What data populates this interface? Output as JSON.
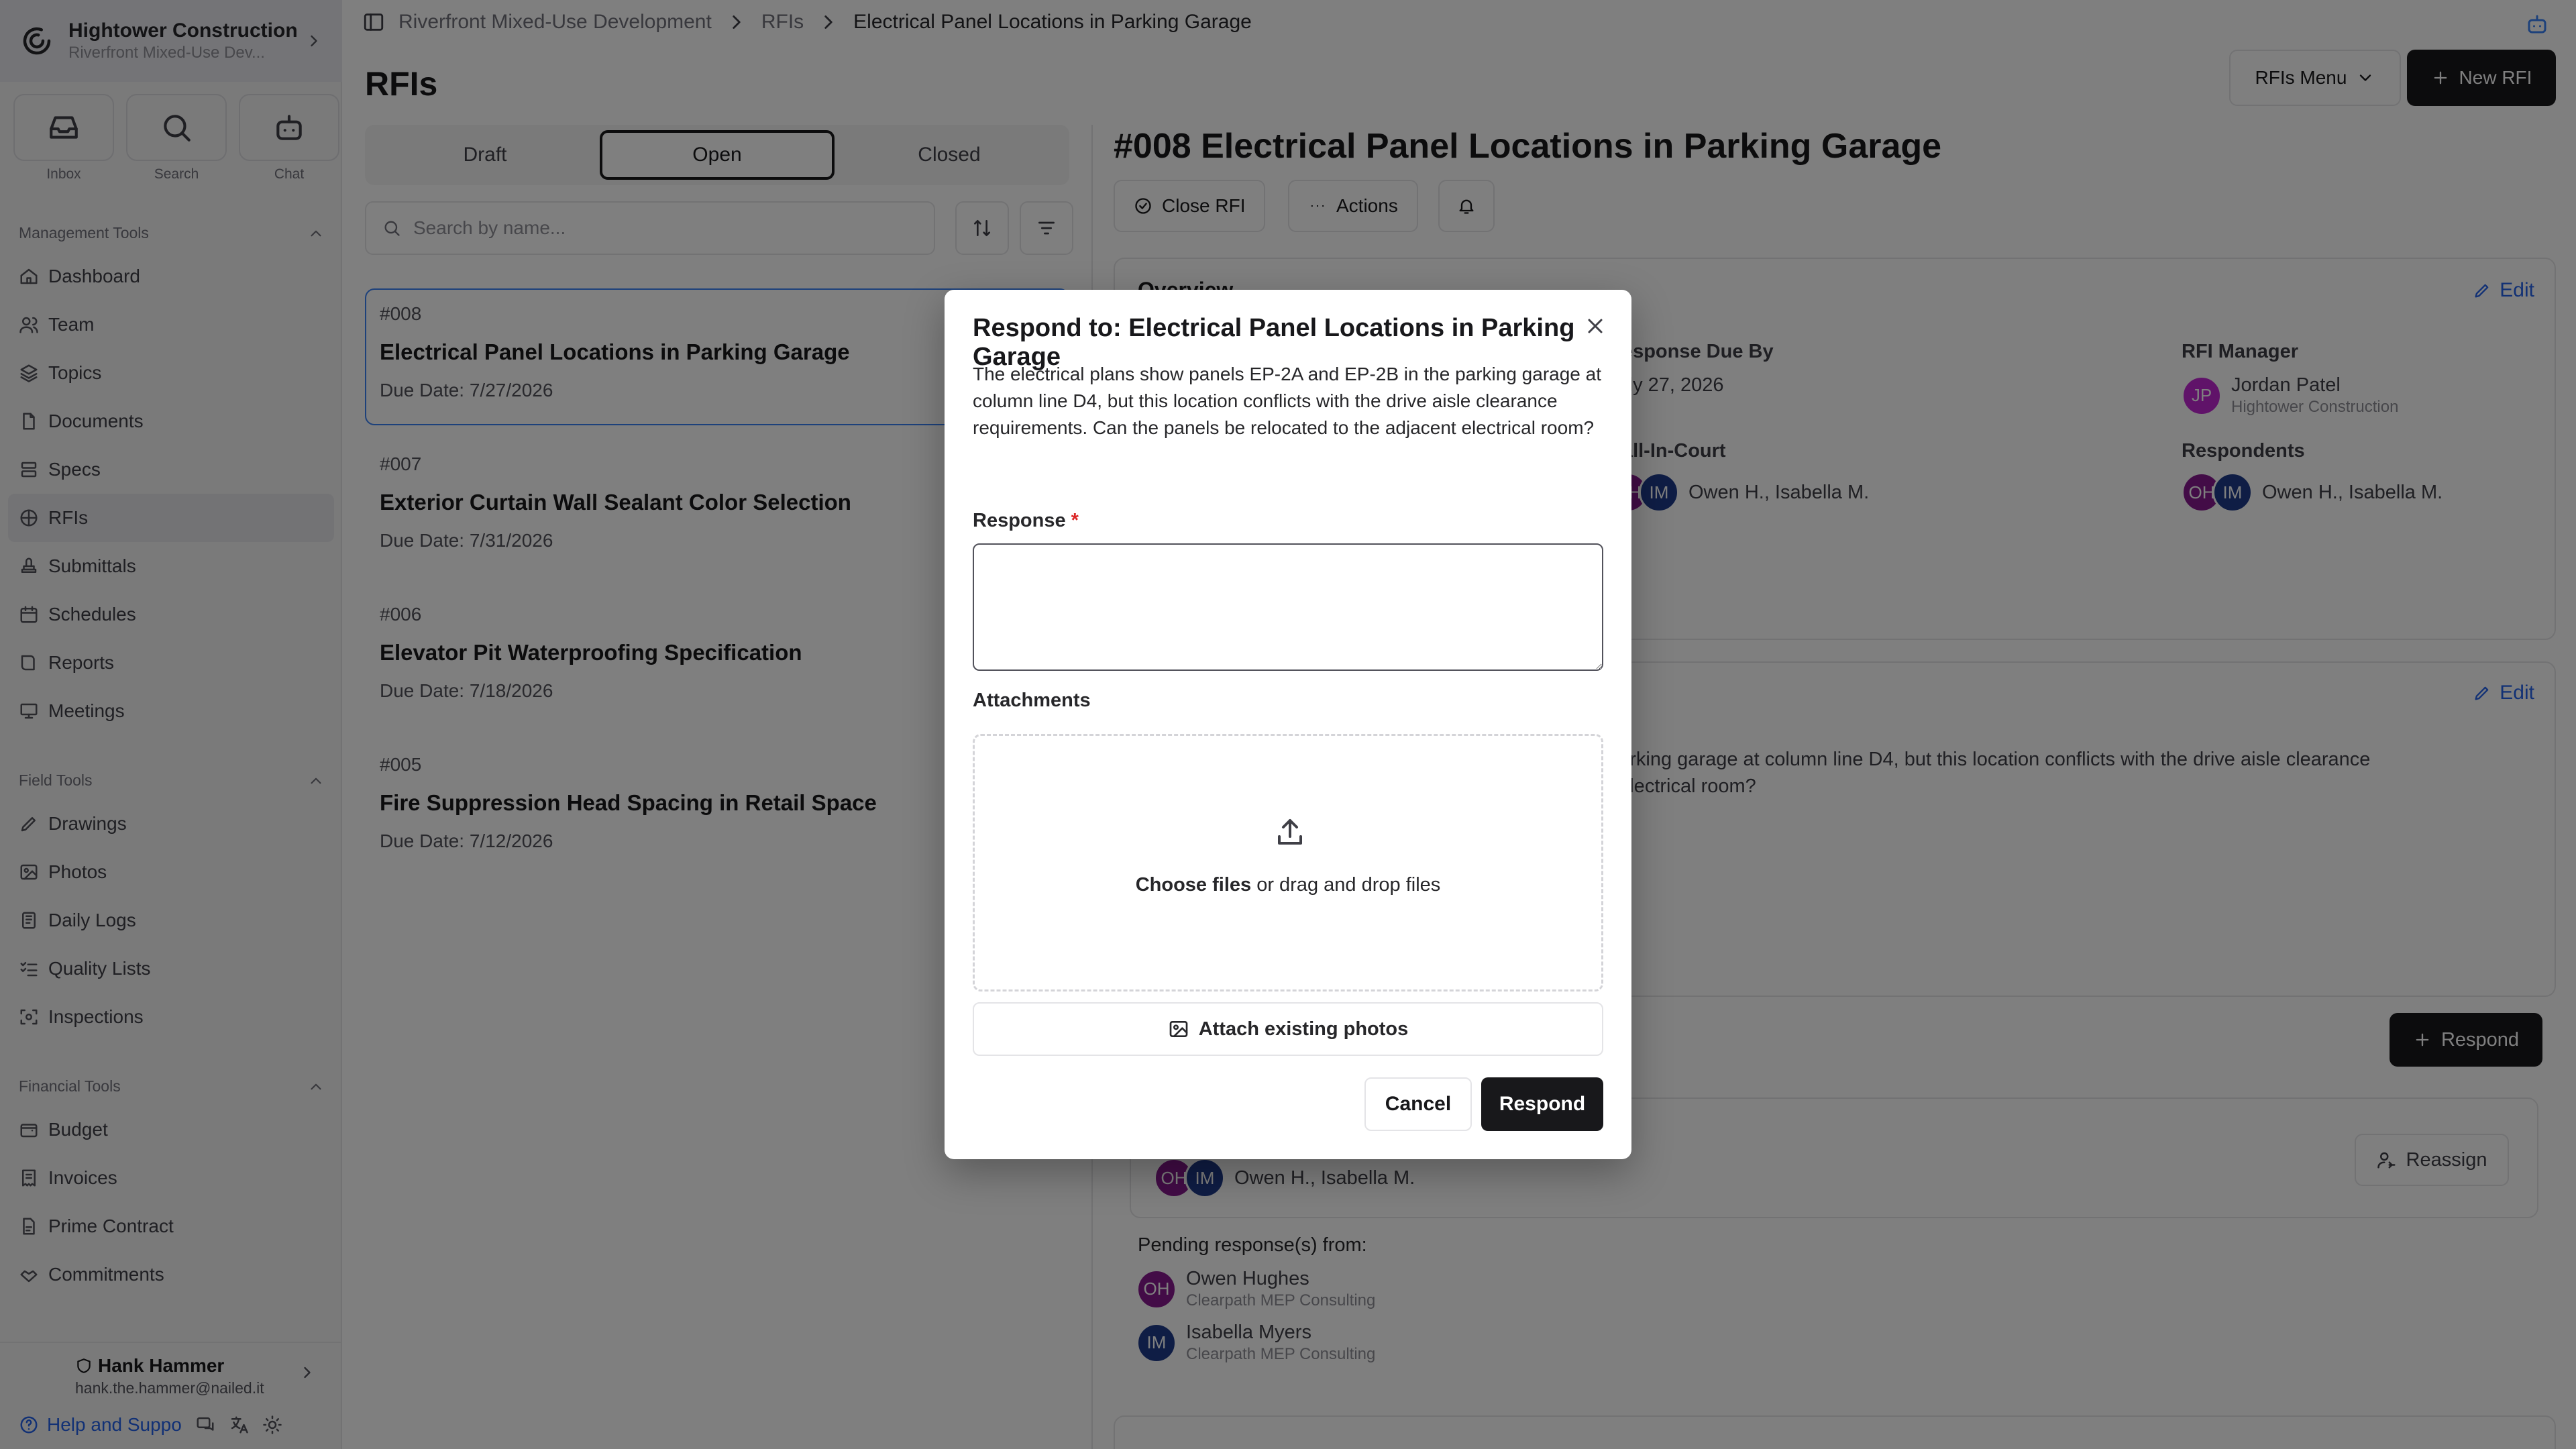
{
  "workspace": {
    "name": "Hightower Construction",
    "project": "Riverfront Mixed-Use Dev..."
  },
  "quick": {
    "inbox": "Inbox",
    "search": "Search",
    "chat": "Chat"
  },
  "sections": {
    "management": "Management Tools",
    "field": "Field Tools",
    "financial": "Financial Tools"
  },
  "nav_management": [
    {
      "label": "Dashboard",
      "icon": "home-icon"
    },
    {
      "label": "Team",
      "icon": "users-icon"
    },
    {
      "label": "Topics",
      "icon": "layers-icon"
    },
    {
      "label": "Documents",
      "icon": "file-icon"
    },
    {
      "label": "Specs",
      "icon": "stack-icon"
    },
    {
      "label": "RFIs",
      "icon": "rfi-icon"
    },
    {
      "label": "Submittals",
      "icon": "stamp-icon"
    },
    {
      "label": "Schedules",
      "icon": "calendar-icon"
    },
    {
      "label": "Reports",
      "icon": "book-icon"
    },
    {
      "label": "Meetings",
      "icon": "presentation-icon"
    }
  ],
  "nav_field": [
    {
      "label": "Drawings",
      "icon": "drawing-icon"
    },
    {
      "label": "Photos",
      "icon": "photo-icon"
    },
    {
      "label": "Daily Logs",
      "icon": "notebook-icon"
    },
    {
      "label": "Quality Lists",
      "icon": "checklist-icon"
    },
    {
      "label": "Inspections",
      "icon": "scan-icon"
    }
  ],
  "nav_financial": [
    {
      "label": "Budget",
      "icon": "wallet-icon"
    },
    {
      "label": "Invoices",
      "icon": "receipt-icon"
    },
    {
      "label": "Prime Contract",
      "icon": "contract-icon"
    },
    {
      "label": "Commitments",
      "icon": "handshake-icon"
    }
  ],
  "user": {
    "name": "Hank Hammer",
    "email": "hank.the.hammer@nailed.it"
  },
  "help": {
    "label": "Help and Suppo"
  },
  "breadcrumb": {
    "project": "Riverfront Mixed-Use Development",
    "section": "RFIs",
    "current": "Electrical Panel Locations in Parking Garage"
  },
  "page": {
    "title": "RFIs",
    "menu_label": "RFIs Menu",
    "new_label": "New RFI"
  },
  "tabs": [
    "Draft",
    "Open",
    "Closed"
  ],
  "search": {
    "placeholder": "Search by name..."
  },
  "rfis": [
    {
      "num": "#008",
      "title": "Electrical Panel Locations in Parking Garage",
      "due": "Due Date: 7/27/2026"
    },
    {
      "num": "#007",
      "title": "Exterior Curtain Wall Sealant Color Selection",
      "due": "Due Date: 7/31/2026"
    },
    {
      "num": "#006",
      "title": "Elevator Pit Waterproofing Specification",
      "due": "Due Date: 7/18/2026"
    },
    {
      "num": "#005",
      "title": "Fire Suppression Head Spacing in Retail Space",
      "due": "Due Date: 7/12/2026"
    }
  ],
  "detail": {
    "title": "#008 Electrical Panel Locations in Parking Garage",
    "close_label": "Close RFI",
    "actions_label": "Actions",
    "overview": "Overview",
    "edit": "Edit",
    "due_by_label": "Response Due By",
    "due_by": "July 27, 2026",
    "manager_label": "RFI Manager",
    "manager_name": "Jordan Patel",
    "manager_org": "Hightower Construction",
    "manager_initials": "JP",
    "bic_label": "Ball-In-Court",
    "bic_names": "Owen H., Isabella M.",
    "respondents_label": "Respondents",
    "respondents_names": "Owen H., Isabella M.",
    "question_line1": "parking garage at column line D4, but this location conflicts with the drive aisle clearance",
    "question_line2": "t electrical room?",
    "respond_label": "Respond",
    "reassign_label": "Reassign",
    "assigned_names": "Owen H., Isabella M.",
    "pending_label": "Pending response(s) from:",
    "pending": [
      {
        "initials": "OH",
        "name": "Owen Hughes",
        "org": "Clearpath MEP Consulting"
      },
      {
        "initials": "IM",
        "name": "Isabella Myers",
        "org": "Clearpath MEP Consulting"
      }
    ]
  },
  "initials": {
    "oh": "OH",
    "im": "IM"
  },
  "modal": {
    "title": "Respond to: Electrical Panel Locations in Parking Garage",
    "question": "The electrical plans show panels EP-2A and EP-2B in the parking garage at column line D4, but this location conflicts with the drive aisle clearance requirements. Can the panels be relocated to the adjacent electrical room?",
    "response_label": "Response",
    "required_mark": "*",
    "response_value": "",
    "attachments_label": "Attachments",
    "choose_files": "Choose files",
    "drop_text": " or drag and drop files",
    "attach_existing": "Attach existing photos",
    "cancel": "Cancel",
    "respond": "Respond"
  },
  "colors": {
    "accent": "#2563eb",
    "selected_border": "#3b82f6",
    "avatar_oh": "#86198f",
    "avatar_im": "#1e3a8a",
    "avatar_jp": "#c026d3"
  }
}
